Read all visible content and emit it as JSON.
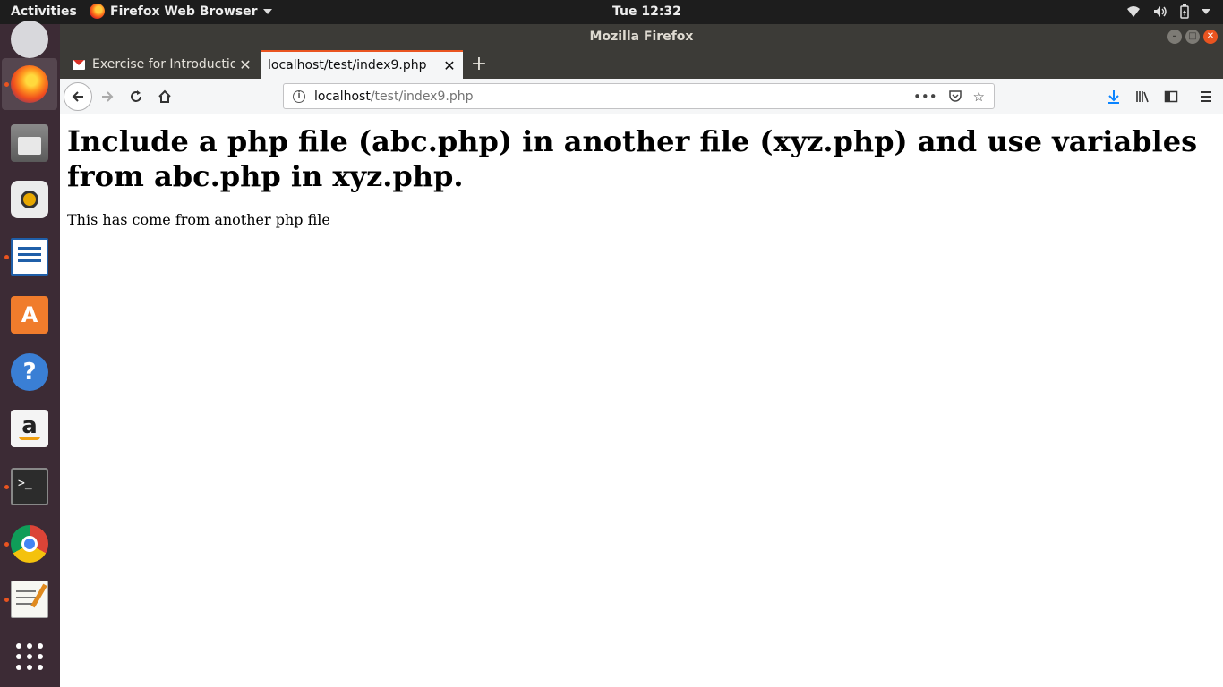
{
  "topbar": {
    "activities": "Activities",
    "app_menu": "Firefox Web Browser",
    "clock": "Tue 12:32"
  },
  "window": {
    "title": "Mozilla Firefox"
  },
  "tabs": [
    {
      "title": "Exercise for Introduction",
      "active": false
    },
    {
      "title": "localhost/test/index9.php",
      "active": true
    }
  ],
  "urlbar": {
    "host": "localhost",
    "path": "/test/index9.php"
  },
  "page": {
    "heading": "Include a php file (abc.php) in another file (xyz.php) and use variables from abc.php in xyz.php.",
    "paragraph": "This has come from another php file"
  },
  "dock": {
    "items": [
      "mail-icon",
      "firefox-icon",
      "files-icon",
      "rhythmbox-icon",
      "libreoffice-writer-icon",
      "software-center-icon",
      "help-icon",
      "amazon-icon",
      "terminal-icon",
      "chrome-icon",
      "text-editor-icon",
      "show-apps-icon"
    ]
  },
  "colors": {
    "accent": "#e95420",
    "dock_bg": "#3c2b35",
    "titlebar_bg": "#3c3b37"
  }
}
